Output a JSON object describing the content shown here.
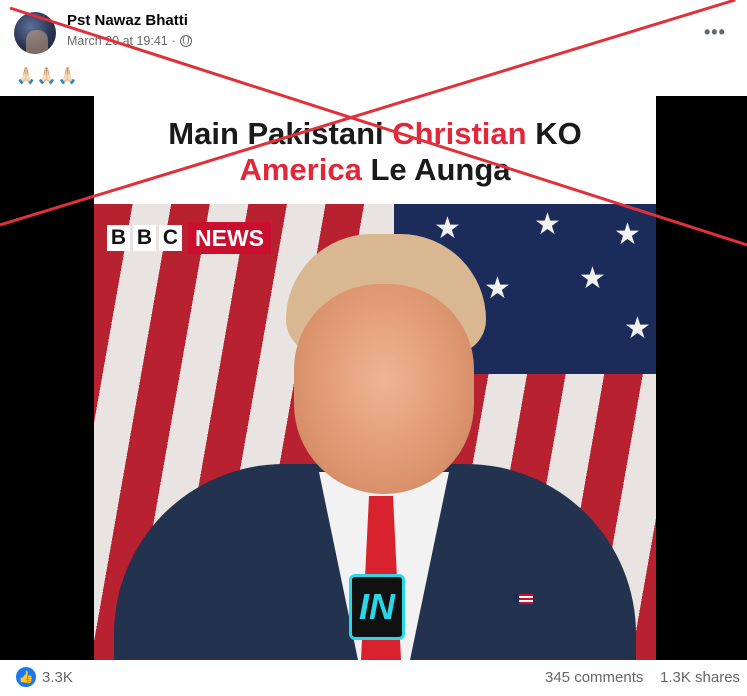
{
  "post": {
    "author": "Pst Nawaz Bhatti",
    "timestamp": "March 20 at 19:41",
    "privacy_icon": "globe-icon",
    "more_icon": "more-options-icon",
    "more_glyph": "•••",
    "caption": "🙏🏻🙏🏻🙏🏻"
  },
  "video": {
    "title_line1_part1": "Main Pakistani ",
    "title_line1_red": "Christian",
    "title_line1_part2": " KO",
    "title_line2_red": "America",
    "title_line2_part2": " Le Aunga",
    "logo_letters": [
      "B",
      "B",
      "C"
    ],
    "logo_news": "NEWS",
    "badge_text": "IN"
  },
  "stats": {
    "reactions": "3.3K",
    "comments": "345 comments",
    "shares": "1.3K shares"
  },
  "colors": {
    "accent": "#1877f2",
    "cross": "#e0313b",
    "title_red": "#e0283a",
    "news_red": "#c8102e"
  }
}
